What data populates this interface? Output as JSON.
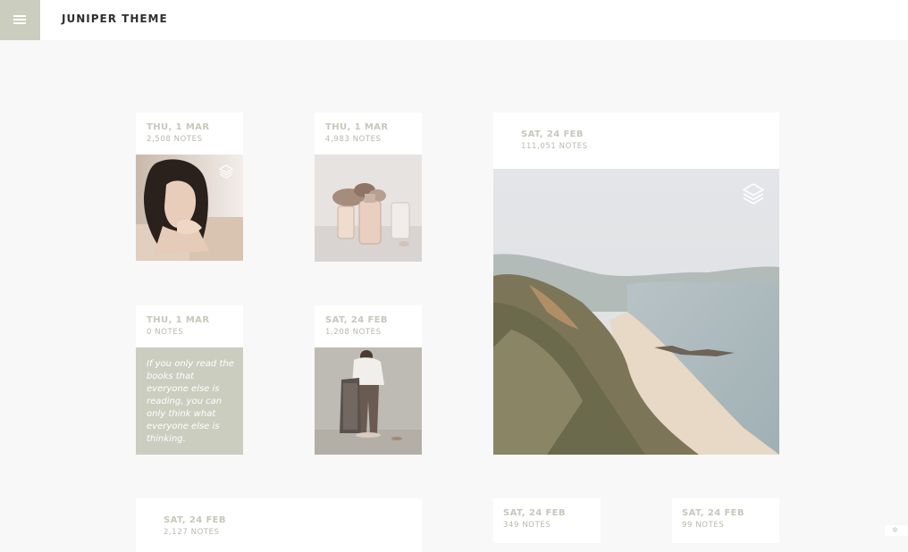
{
  "header": {
    "title": "JUNIPER THEME",
    "menu_icon": "hamburger-menu-icon"
  },
  "posts": [
    {
      "date": "THU, 1 MAR",
      "notes": "2,508 NOTES",
      "type": "photoset",
      "subject": "woman with dark hair resting chin on hand"
    },
    {
      "date": "THU, 1 MAR",
      "notes": "4,983 NOTES",
      "type": "photo",
      "subject": "perfume bottles and dried roses"
    },
    {
      "date": "SAT, 24 FEB",
      "notes": "111,051 NOTES",
      "type": "photoset",
      "subject": "coastal cliffs and sandy beach"
    },
    {
      "date": "THU, 1 MAR",
      "notes": "0 NOTES",
      "type": "quote",
      "quote": "If you only read the books that everyone else is reading, you can only think what everyone else is thinking."
    },
    {
      "date": "SAT, 24 FEB",
      "notes": "1,208 NOTES",
      "type": "photo",
      "subject": "woman with striped coat on hanger"
    },
    {
      "date": "SAT, 24 FEB",
      "notes": "2,127 NOTES",
      "type": "post"
    },
    {
      "date": "SAT, 24 FEB",
      "notes": "349 NOTES",
      "type": "post"
    },
    {
      "date": "SAT, 24 FEB",
      "notes": "99 NOTES",
      "type": "post"
    }
  ],
  "colors": {
    "accent": "#cbcdbf",
    "page_background": "#f8f8f8",
    "card_background": "#ffffff",
    "meta_text": "#c6c8ba",
    "title_text": "#2f2f2f"
  }
}
